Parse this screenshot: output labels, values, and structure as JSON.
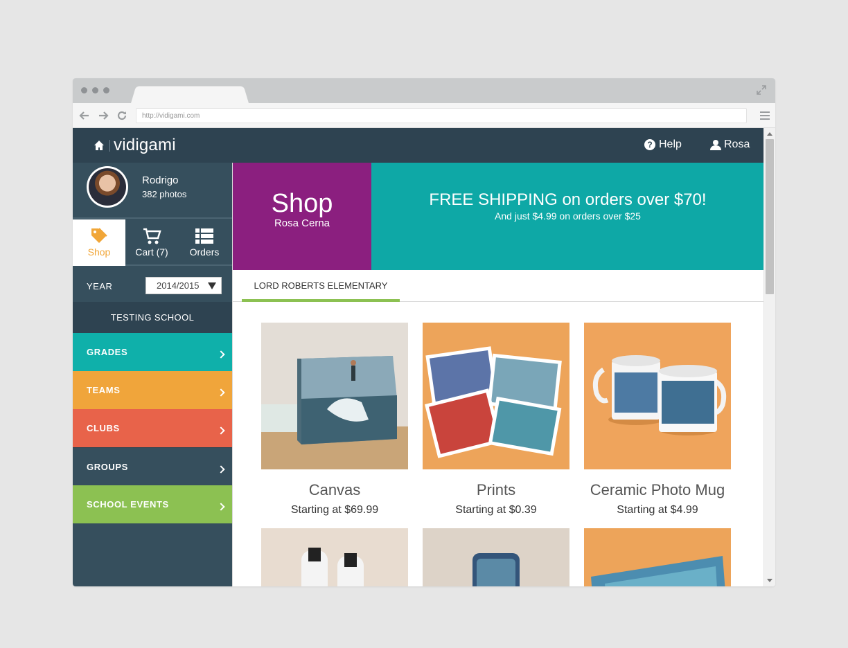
{
  "browser": {
    "url": "http://vidigami.com"
  },
  "nav": {
    "logo_text": "vidigami",
    "help": "Help",
    "user": "Rosa"
  },
  "profile": {
    "name": "Rodrigo",
    "count": "382 photos"
  },
  "actions": [
    {
      "label": "Shop",
      "icon": "tag-icon"
    },
    {
      "label": "Cart (7)",
      "icon": "cart-icon"
    },
    {
      "label": "Orders",
      "icon": "list-icon"
    }
  ],
  "year": {
    "label": "YEAR",
    "value": "2014/2015"
  },
  "school_name": "TESTING SCHOOL",
  "categories": [
    {
      "label": "GRADES",
      "color": "#0fb0aa"
    },
    {
      "label": "TEAMS",
      "color": "#f0a53b"
    },
    {
      "label": "CLUBS",
      "color": "#e8634a"
    },
    {
      "label": "GROUPS",
      "color": "#364f5d"
    },
    {
      "label": "SCHOOL EVENTS",
      "color": "#8cc152"
    }
  ],
  "banner": {
    "title": "Shop",
    "subtitle": "Rosa Cerna",
    "promo_heading": "FREE SHIPPING on orders over $70!",
    "promo_sub": "And just $4.99 on orders over $25",
    "shop_color": "#8b1f7f",
    "promo_color": "#0ea8a6"
  },
  "school_tab": "LORD ROBERTS ELEMENTARY",
  "products": [
    {
      "title": "Canvas",
      "price": "Starting at $69.99"
    },
    {
      "title": "Prints",
      "price": "Starting at $0.39"
    },
    {
      "title": "Ceramic Photo Mug",
      "price": "Starting at $4.99"
    }
  ]
}
